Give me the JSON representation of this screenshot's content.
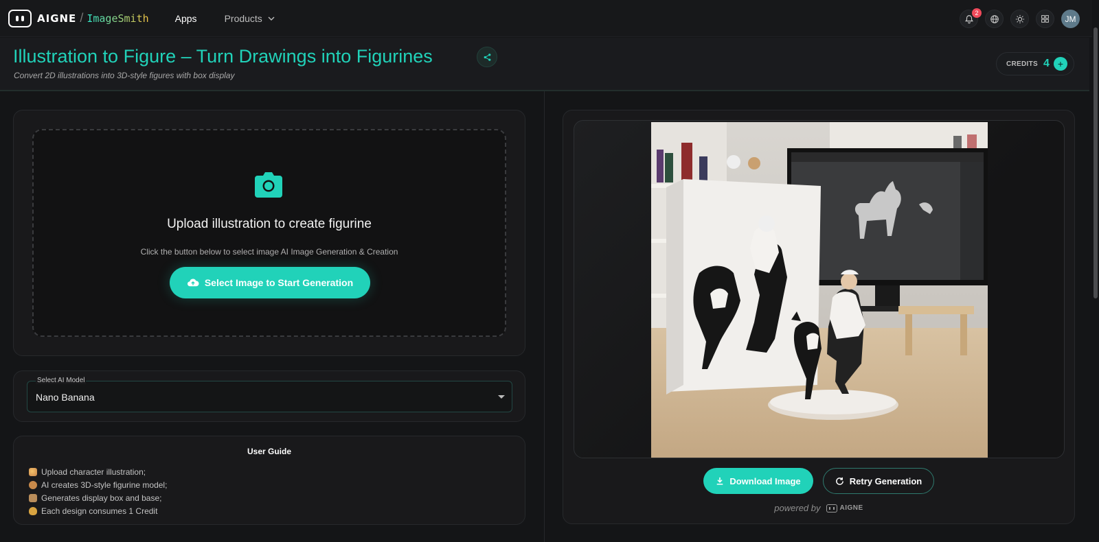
{
  "brand": {
    "name": "AIGNE",
    "product": "ImageSmith"
  },
  "nav": {
    "apps": "Apps",
    "products": "Products"
  },
  "topbar": {
    "notifications_count": "2",
    "avatar_initials": "JM"
  },
  "header": {
    "title": "Illustration to Figure – Turn Drawings into Figurines",
    "subtitle": "Convert 2D illustrations into 3D-style figures with box display",
    "credits_label": "CREDITS",
    "credits_value": "4"
  },
  "upload": {
    "title": "Upload illustration to create figurine",
    "hint": "Click the button below to select image AI Image Generation & Creation",
    "button": "Select Image to Start Generation"
  },
  "model": {
    "label": "Select AI Model",
    "value": "Nano Banana"
  },
  "guide": {
    "title": "User Guide",
    "items": [
      "Upload character illustration;",
      "AI creates 3D-style figurine model;",
      "Generates display box and base;",
      "Each design consumes 1 Credit"
    ]
  },
  "result": {
    "download": "Download Image",
    "retry": "Retry Generation",
    "powered_by": "powered by",
    "powered_brand": "AIGNE"
  },
  "colors": {
    "accent": "#21d2b9",
    "background": "#141517",
    "badge": "#f04a5b"
  }
}
